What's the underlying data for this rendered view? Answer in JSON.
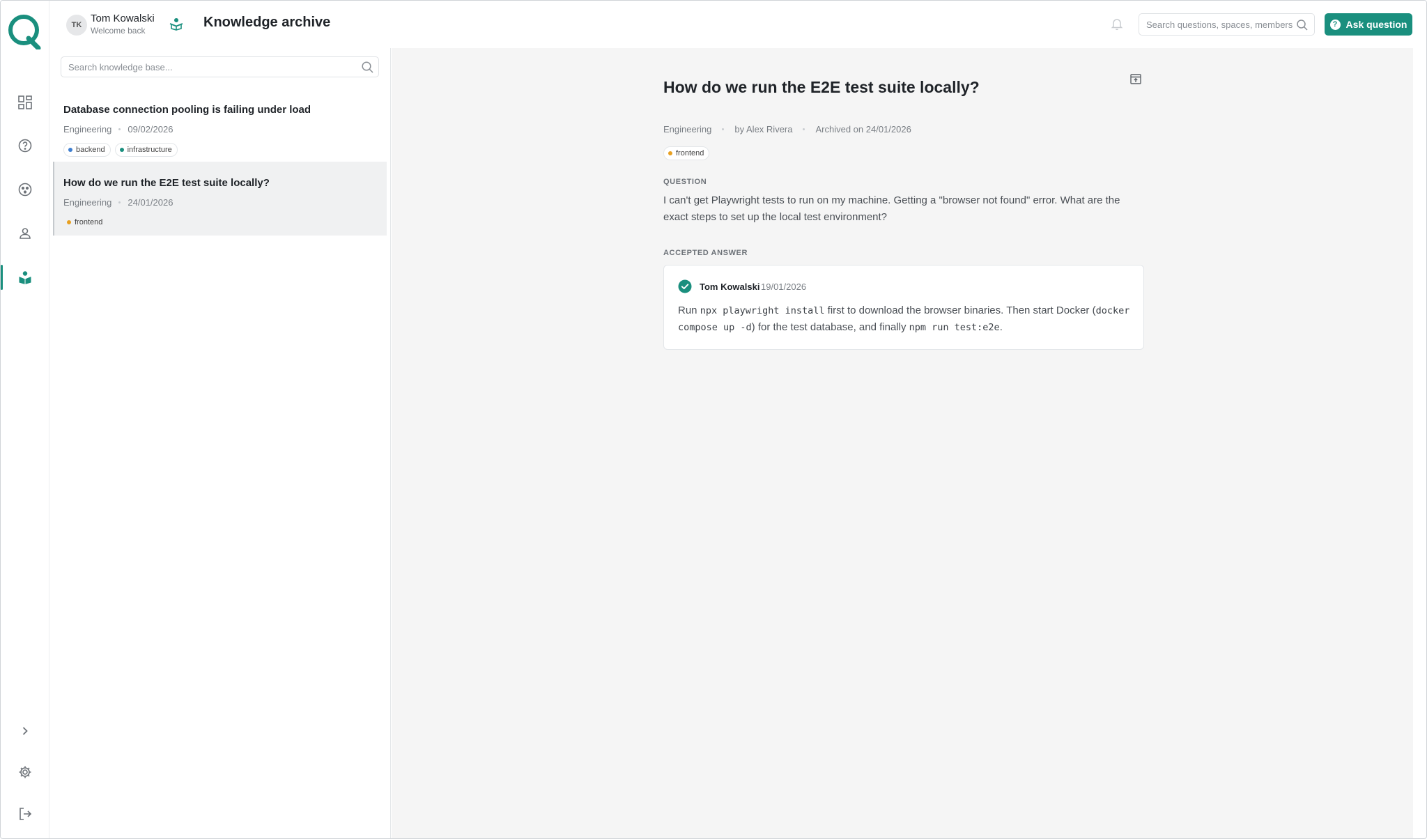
{
  "header": {
    "user": {
      "initials": "TK",
      "name": "Tom Kowalski",
      "subtitle": "Welcome back"
    },
    "page_title": "Knowledge archive",
    "search_placeholder": "Search questions, spaces, members",
    "ask_button_label": "Ask question"
  },
  "rail": {
    "items": [
      "dashboard-icon",
      "questions-icon",
      "spaces-icon",
      "members-icon",
      "archive-icon"
    ],
    "active": "archive-icon",
    "bottom": [
      "expand-chevron-icon",
      "settings-icon",
      "logout-icon"
    ]
  },
  "list": {
    "search_placeholder": "Search knowledge base...",
    "items": [
      {
        "title": "Database connection pooling is failing under load",
        "space": "Engineering",
        "date": "09/02/2026",
        "tags": [
          {
            "label": "backend",
            "color": "#3f7fd0"
          },
          {
            "label": "infrastructure",
            "color": "#1a8f7e"
          }
        ]
      },
      {
        "title": "How do we run the E2E test suite locally?",
        "space": "Engineering",
        "date": "24/01/2026",
        "tags": [
          {
            "label": "frontend",
            "color": "#e8a020"
          }
        ]
      }
    ]
  },
  "detail": {
    "title": "How do we run the E2E test suite locally?",
    "space": "Engineering",
    "author": "by Alex Rivera",
    "archived": "Archived on 24/01/2026",
    "tag": {
      "label": "frontend",
      "color": "#e8a020"
    },
    "question_label": "QUESTION",
    "question_text": "I can't get Playwright tests to run on my machine. Getting a \"browser not found\" error. What are the exact steps to set up the local test environment?",
    "answer_label": "ACCEPTED ANSWER",
    "answer": {
      "author": "Tom Kowalski",
      "date": "19/01/2026",
      "parts": {
        "t1": "Run ",
        "c1": "npx playwright install",
        "t2": " first to download the browser binaries. Then start Docker (",
        "c2": "docker compose up -d",
        "t3": ") for the test database, and finally ",
        "c3": "npm run test:e2e",
        "t4": "."
      }
    }
  },
  "colors": {
    "accent": "#1a8f7e",
    "detail_bg": "#f5f5f5"
  }
}
